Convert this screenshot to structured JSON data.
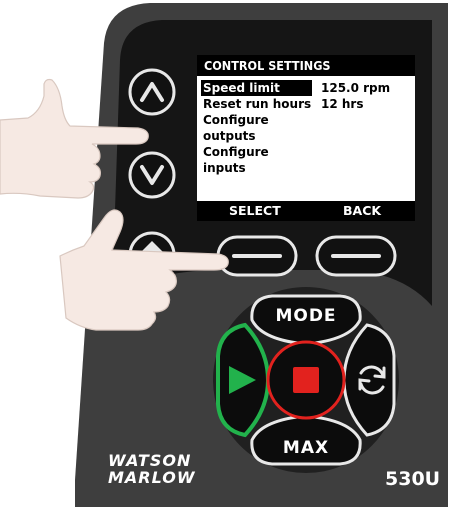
{
  "screen": {
    "title": "CONTROL SETTINGS",
    "menu": [
      {
        "label": "Speed limit",
        "value": "125.0 rpm",
        "selected": true
      },
      {
        "label": "Reset run hours",
        "value": "12 hrs",
        "selected": false
      },
      {
        "label": "Configure",
        "value": "",
        "selected": false
      },
      {
        "label": "outputs",
        "value": "",
        "selected": false
      },
      {
        "label": "Configure",
        "value": "",
        "selected": false
      },
      {
        "label": "inputs",
        "value": "",
        "selected": false
      }
    ],
    "softkeys": {
      "left": "SELECT",
      "right": "BACK"
    }
  },
  "keypad": {
    "mode_label": "MODE",
    "max_label": "MAX"
  },
  "brand": {
    "line1": "WATSON",
    "line2": "MARLOW"
  },
  "model": "530U",
  "colors": {
    "housing": "#3d3d3d",
    "panel": "#141414",
    "run_green": "#22b24c",
    "stop_red": "#e2221e",
    "skin": "#f6e9e3"
  }
}
